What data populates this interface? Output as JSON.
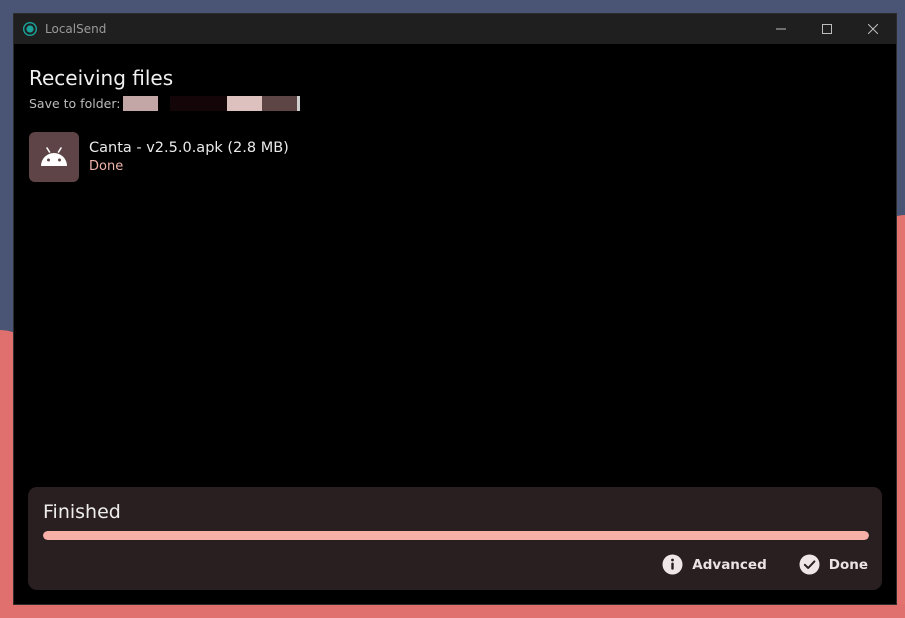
{
  "window": {
    "title": "LocalSend"
  },
  "page": {
    "title": "Receiving files",
    "save_label": "Save to folder:"
  },
  "files": [
    {
      "name": "Canta - v2.5.0.apk (2.8 MB)",
      "status": "Done",
      "icon": "android-icon"
    }
  ],
  "transfer": {
    "status": "Finished",
    "progress": 1.0
  },
  "actions": {
    "advanced_label": "Advanced",
    "done_label": "Done"
  },
  "colors": {
    "accent": "#f6b0a7",
    "status_text": "#f0b4ac",
    "card_bg": "#2a1f20",
    "thumb_bg": "#5e4446"
  }
}
